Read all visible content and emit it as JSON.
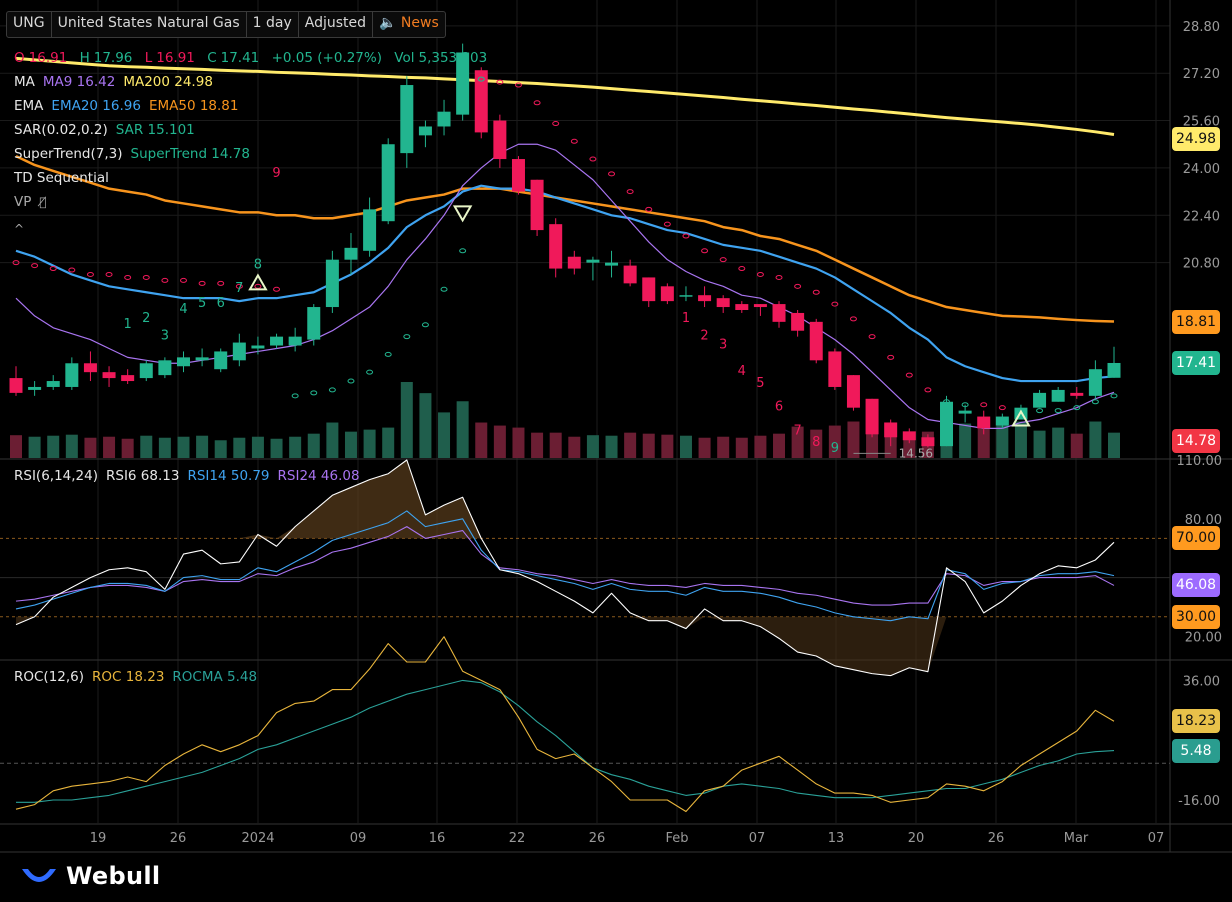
{
  "toolbar": {
    "symbol": "UNG",
    "name": "United States Natural Gas",
    "interval": "1 day",
    "adjust": "Adjusted",
    "news_label": "News"
  },
  "legend": {
    "ohlc": {
      "o_label": "O",
      "o": "16.91",
      "h_label": "H",
      "h": "17.96",
      "l_label": "L",
      "l": "16.91",
      "c_label": "C",
      "c": "17.41",
      "change": "+0.05 (+0.27%)",
      "vol_label": "Vol",
      "vol": "5,353,303"
    },
    "ma": {
      "name": "MA",
      "ma9": "MA9 16.42",
      "ma200": "MA200 24.98"
    },
    "ema": {
      "name": "EMA",
      "ema20": "EMA20 16.96",
      "ema50": "EMA50 18.81"
    },
    "sar": {
      "name": "SAR(0.02,0.2)",
      "sar": "SAR 15.101"
    },
    "supertrend": {
      "name": "SuperTrend(7,3)",
      "value": "SuperTrend 14.78"
    },
    "td": {
      "name": "TD Sequential"
    },
    "vp": {
      "name": "VP"
    },
    "rsi": {
      "name": "RSI(6,14,24)",
      "rsi6": "RSI6 68.13",
      "rsi14": "RSI14 50.79",
      "rsi24": "RSI24 46.08"
    },
    "roc": {
      "name": "ROC(12,6)",
      "roc": "ROC 18.23",
      "rocma": "ROCMA 5.48"
    }
  },
  "price_tags": [
    {
      "text": "24.98",
      "color": "#ffea6b"
    },
    {
      "text": "18.81",
      "color": "#ff9a1f"
    },
    {
      "text": "17.41",
      "color": "#22b58f"
    },
    {
      "text": "14.78",
      "color": "#f23645"
    },
    {
      "text": "70.00",
      "color": "#ff9a1f"
    },
    {
      "text": "46.08",
      "color": "#9d6bff"
    },
    {
      "text": "30.00",
      "color": "#ff9a1f"
    },
    {
      "text": "18.23",
      "color": "#e8c14a"
    },
    {
      "text": "5.48",
      "color": "#2a9d8f"
    }
  ],
  "colors": {
    "up": "#22b58f",
    "down": "#f0195a",
    "ma9": "#a874f0",
    "ma200": "#ffea6b",
    "ema20": "#3fa3f0",
    "ema50": "#f7941d",
    "rsi6": "#ffffff",
    "rsi14": "#3fa3f0",
    "rsi24": "#a874f0",
    "roc": "#e8b53c",
    "rocma": "#2aa198",
    "grid": "#222222",
    "logo": "#2f6bff"
  },
  "min_label": "14.56",
  "td_labels": {
    "buy_early": [
      "1",
      "2",
      "3",
      "4",
      "5",
      "6",
      "7",
      "8",
      "9"
    ],
    "sell_down": [
      "1",
      "2",
      "3",
      "4",
      "5",
      "6",
      "7",
      "8",
      "9"
    ]
  },
  "branding": "Webull",
  "chart_data": {
    "type": "candlestick",
    "price_axis": {
      "ticks": [
        "28.80",
        "27.20",
        "25.60",
        "24.00",
        "22.40",
        "20.80"
      ],
      "range": [
        14.2,
        29.2
      ]
    },
    "rsi_axis": {
      "ticks": [
        "110.00",
        "80.00",
        "20.00"
      ],
      "range": [
        10,
        110
      ]
    },
    "roc_axis": {
      "ticks": [
        "36.00",
        "-16.00"
      ],
      "range": [
        -26,
        44
      ]
    },
    "x_ticks": [
      "19",
      "26",
      "2024",
      "09",
      "16",
      "22",
      "26",
      "Feb",
      "07",
      "13",
      "20",
      "26",
      "Mar",
      "07"
    ],
    "candles": [
      {
        "o": 16.9,
        "h": 17.3,
        "l": 16.3,
        "c": 16.4
      },
      {
        "o": 16.5,
        "h": 16.8,
        "l": 16.3,
        "c": 16.6
      },
      {
        "o": 16.6,
        "h": 17.0,
        "l": 16.5,
        "c": 16.8
      },
      {
        "o": 16.6,
        "h": 17.6,
        "l": 16.5,
        "c": 17.4
      },
      {
        "o": 17.4,
        "h": 17.8,
        "l": 16.8,
        "c": 17.1
      },
      {
        "o": 17.1,
        "h": 17.3,
        "l": 16.6,
        "c": 16.9
      },
      {
        "o": 17.0,
        "h": 17.2,
        "l": 16.7,
        "c": 16.8
      },
      {
        "o": 16.9,
        "h": 17.5,
        "l": 16.8,
        "c": 17.4
      },
      {
        "o": 17.0,
        "h": 17.6,
        "l": 16.9,
        "c": 17.5
      },
      {
        "o": 17.3,
        "h": 17.8,
        "l": 17.1,
        "c": 17.6
      },
      {
        "o": 17.5,
        "h": 17.9,
        "l": 17.3,
        "c": 17.6
      },
      {
        "o": 17.2,
        "h": 17.9,
        "l": 17.1,
        "c": 17.8
      },
      {
        "o": 17.5,
        "h": 18.4,
        "l": 17.3,
        "c": 18.1
      },
      {
        "o": 17.9,
        "h": 18.3,
        "l": 17.7,
        "c": 18.0
      },
      {
        "o": 18.0,
        "h": 18.4,
        "l": 17.9,
        "c": 18.3
      },
      {
        "o": 18.0,
        "h": 18.6,
        "l": 17.8,
        "c": 18.3
      },
      {
        "o": 18.2,
        "h": 19.4,
        "l": 18.0,
        "c": 19.3
      },
      {
        "o": 19.3,
        "h": 21.2,
        "l": 19.1,
        "c": 20.9
      },
      {
        "o": 20.9,
        "h": 21.8,
        "l": 20.4,
        "c": 21.3
      },
      {
        "o": 21.2,
        "h": 23.0,
        "l": 21.0,
        "c": 22.6
      },
      {
        "o": 22.2,
        "h": 25.0,
        "l": 22.1,
        "c": 24.8
      },
      {
        "o": 24.5,
        "h": 27.1,
        "l": 24.0,
        "c": 26.8
      },
      {
        "o": 25.1,
        "h": 25.6,
        "l": 24.7,
        "c": 25.4
      },
      {
        "o": 25.4,
        "h": 26.3,
        "l": 25.1,
        "c": 25.9
      },
      {
        "o": 25.8,
        "h": 28.2,
        "l": 25.6,
        "c": 27.9
      },
      {
        "o": 27.3,
        "h": 27.4,
        "l": 25.0,
        "c": 25.2
      },
      {
        "o": 25.6,
        "h": 25.8,
        "l": 24.0,
        "c": 24.3
      },
      {
        "o": 24.3,
        "h": 24.4,
        "l": 23.1,
        "c": 23.2
      },
      {
        "o": 23.6,
        "h": 23.6,
        "l": 21.7,
        "c": 21.9
      },
      {
        "o": 22.1,
        "h": 22.3,
        "l": 20.3,
        "c": 20.6
      },
      {
        "o": 21.0,
        "h": 21.2,
        "l": 20.4,
        "c": 20.6
      },
      {
        "o": 20.8,
        "h": 21.0,
        "l": 20.2,
        "c": 20.9
      },
      {
        "o": 20.7,
        "h": 21.2,
        "l": 20.3,
        "c": 20.8
      },
      {
        "o": 20.7,
        "h": 20.9,
        "l": 20.0,
        "c": 20.1
      },
      {
        "o": 20.3,
        "h": 20.3,
        "l": 19.3,
        "c": 19.5
      },
      {
        "o": 20.0,
        "h": 20.1,
        "l": 19.4,
        "c": 19.5
      },
      {
        "o": 19.7,
        "h": 20.0,
        "l": 19.5,
        "c": 19.7
      },
      {
        "o": 19.7,
        "h": 20.0,
        "l": 19.3,
        "c": 19.5
      },
      {
        "o": 19.6,
        "h": 19.7,
        "l": 19.1,
        "c": 19.3
      },
      {
        "o": 19.4,
        "h": 19.5,
        "l": 19.1,
        "c": 19.2
      },
      {
        "o": 19.4,
        "h": 19.4,
        "l": 19.0,
        "c": 19.3
      },
      {
        "o": 19.4,
        "h": 19.5,
        "l": 18.6,
        "c": 18.8
      },
      {
        "o": 19.1,
        "h": 19.2,
        "l": 18.3,
        "c": 18.5
      },
      {
        "o": 18.8,
        "h": 18.9,
        "l": 17.4,
        "c": 17.5
      },
      {
        "o": 17.8,
        "h": 17.9,
        "l": 16.5,
        "c": 16.6
      },
      {
        "o": 17.0,
        "h": 17.0,
        "l": 15.8,
        "c": 15.9
      },
      {
        "o": 16.2,
        "h": 16.2,
        "l": 14.9,
        "c": 15.0
      },
      {
        "o": 15.4,
        "h": 15.5,
        "l": 14.6,
        "c": 14.9
      },
      {
        "o": 15.1,
        "h": 15.2,
        "l": 14.7,
        "c": 14.8
      },
      {
        "o": 14.9,
        "h": 15.0,
        "l": 14.56,
        "c": 14.6
      },
      {
        "o": 14.6,
        "h": 16.3,
        "l": 14.6,
        "c": 16.1
      },
      {
        "o": 15.7,
        "h": 16.0,
        "l": 15.4,
        "c": 15.8
      },
      {
        "o": 15.6,
        "h": 15.8,
        "l": 15.0,
        "c": 15.2
      },
      {
        "o": 15.3,
        "h": 15.7,
        "l": 15.2,
        "c": 15.6
      },
      {
        "o": 15.5,
        "h": 16.0,
        "l": 15.5,
        "c": 15.9
      },
      {
        "o": 15.9,
        "h": 16.5,
        "l": 15.9,
        "c": 16.4
      },
      {
        "o": 16.1,
        "h": 16.6,
        "l": 16.1,
        "c": 16.5
      },
      {
        "o": 16.4,
        "h": 16.6,
        "l": 16.2,
        "c": 16.3
      },
      {
        "o": 16.3,
        "h": 17.5,
        "l": 16.2,
        "c": 17.2
      },
      {
        "o": 16.91,
        "h": 17.96,
        "l": 16.91,
        "c": 17.41
      }
    ],
    "volume": [
      45,
      42,
      44,
      46,
      40,
      42,
      38,
      44,
      40,
      42,
      44,
      35,
      40,
      42,
      38,
      42,
      48,
      70,
      52,
      56,
      60,
      150,
      128,
      90,
      112,
      70,
      64,
      60,
      50,
      50,
      42,
      45,
      44,
      50,
      48,
      46,
      44,
      40,
      42,
      40,
      44,
      48,
      62,
      56,
      64,
      72,
      62,
      55,
      48,
      52,
      74,
      68,
      58,
      66,
      72,
      54,
      60,
      48,
      72,
      50
    ],
    "ma9": [
      19.6,
      19.0,
      18.6,
      18.4,
      18.2,
      17.9,
      17.6,
      17.5,
      17.4,
      17.4,
      17.5,
      17.6,
      17.7,
      17.8,
      17.9,
      18.0,
      18.2,
      18.5,
      18.9,
      19.3,
      20.0,
      20.9,
      21.6,
      22.4,
      23.4,
      24.0,
      24.5,
      24.8,
      24.8,
      24.6,
      24.1,
      23.6,
      22.9,
      22.2,
      21.5,
      20.9,
      20.5,
      20.2,
      20.0,
      19.7,
      19.6,
      19.3,
      19.0,
      18.6,
      18.2,
      17.7,
      17.1,
      16.5,
      15.9,
      15.5,
      15.4,
      15.3,
      15.2,
      15.2,
      15.4,
      15.5,
      15.7,
      15.9,
      16.2,
      16.42
    ],
    "ema20": [
      21.2,
      21.0,
      20.7,
      20.4,
      20.2,
      20.0,
      19.9,
      19.8,
      19.7,
      19.6,
      19.6,
      19.6,
      19.5,
      19.6,
      19.6,
      19.7,
      19.8,
      20.1,
      20.4,
      20.8,
      21.3,
      22.0,
      22.4,
      22.7,
      23.2,
      23.4,
      23.3,
      23.3,
      23.2,
      23.0,
      22.8,
      22.6,
      22.4,
      22.3,
      22.1,
      21.9,
      21.8,
      21.6,
      21.4,
      21.3,
      21.2,
      21.0,
      20.8,
      20.6,
      20.3,
      19.9,
      19.5,
      19.1,
      18.6,
      18.2,
      17.6,
      17.3,
      17.1,
      16.9,
      16.8,
      16.8,
      16.8,
      16.8,
      16.9,
      16.96
    ],
    "ema50": [
      24.4,
      24.1,
      23.9,
      23.7,
      23.5,
      23.3,
      23.2,
      23.1,
      22.9,
      22.8,
      22.7,
      22.6,
      22.5,
      22.5,
      22.4,
      22.4,
      22.3,
      22.3,
      22.4,
      22.5,
      22.7,
      22.9,
      23.0,
      23.1,
      23.3,
      23.3,
      23.3,
      23.2,
      23.1,
      23.0,
      22.9,
      22.8,
      22.7,
      22.6,
      22.5,
      22.4,
      22.3,
      22.2,
      22.0,
      21.9,
      21.7,
      21.6,
      21.4,
      21.2,
      20.9,
      20.6,
      20.3,
      20.0,
      19.7,
      19.5,
      19.3,
      19.2,
      19.1,
      19.0,
      18.98,
      18.95,
      18.9,
      18.86,
      18.83,
      18.81
    ],
    "ma200": [
      27.7,
      27.65,
      27.6,
      27.55,
      27.5,
      27.45,
      27.42,
      27.4,
      27.37,
      27.35,
      27.33,
      27.3,
      27.28,
      27.26,
      27.23,
      27.21,
      27.19,
      27.16,
      27.14,
      27.11,
      27.09,
      27.06,
      27.04,
      27.01,
      26.98,
      26.95,
      26.92,
      26.88,
      26.85,
      26.81,
      26.77,
      26.73,
      26.68,
      26.63,
      26.58,
      26.53,
      26.48,
      26.43,
      26.38,
      26.32,
      26.27,
      26.22,
      26.16,
      26.11,
      26.05,
      25.99,
      25.94,
      25.88,
      25.82,
      25.76,
      25.7,
      25.65,
      25.6,
      25.55,
      25.5,
      25.44,
      25.37,
      25.3,
      25.22,
      25.13
    ],
    "sar": [
      20.8,
      20.7,
      20.6,
      20.55,
      20.4,
      20.4,
      20.3,
      20.3,
      20.2,
      20.2,
      20.1,
      20.1,
      20.0,
      20.0,
      19.9,
      16.3,
      16.4,
      16.5,
      16.8,
      17.1,
      17.7,
      18.3,
      18.7,
      19.9,
      21.2,
      27.0,
      26.9,
      26.8,
      26.2,
      25.5,
      24.9,
      24.3,
      23.8,
      23.2,
      22.6,
      22.1,
      21.7,
      21.2,
      20.9,
      20.6,
      20.4,
      20.3,
      20.0,
      19.8,
      19.4,
      18.9,
      18.3,
      17.6,
      17.0,
      16.5,
      16.1,
      16.0,
      16.0,
      15.9,
      15.8,
      15.8,
      15.8,
      15.9,
      16.1,
      16.3
    ],
    "rsi6": [
      26,
      30,
      40,
      45,
      50,
      54,
      55,
      53,
      44,
      62,
      64,
      57,
      58,
      72,
      66,
      76,
      84,
      92,
      96,
      100,
      103,
      110,
      82,
      87,
      91,
      70,
      54,
      52,
      48,
      43,
      38,
      32,
      42,
      32,
      28,
      28,
      24,
      34,
      28,
      28,
      25,
      19,
      12,
      10,
      5,
      3,
      1,
      0,
      4,
      2,
      55,
      48,
      32,
      38,
      46,
      52,
      56,
      55,
      59,
      68
    ],
    "rsi14": [
      34,
      36,
      39,
      42,
      45,
      47,
      47,
      46,
      43,
      50,
      51,
      49,
      49,
      55,
      53,
      58,
      63,
      69,
      72,
      75,
      78,
      84,
      76,
      78,
      80,
      64,
      54,
      53,
      51,
      49,
      47,
      44,
      47,
      44,
      43,
      43,
      41,
      45,
      43,
      43,
      42,
      40,
      37,
      35,
      32,
      30,
      29,
      28,
      30,
      29,
      54,
      52,
      44,
      47,
      48,
      51,
      52,
      52,
      53,
      51
    ],
    "rsi24": [
      38,
      39,
      41,
      43,
      45,
      46,
      46,
      45,
      43,
      48,
      49,
      48,
      48,
      52,
      51,
      55,
      58,
      63,
      65,
      68,
      71,
      76,
      70,
      72,
      74,
      62,
      55,
      54,
      52,
      51,
      49,
      47,
      49,
      47,
      46,
      46,
      45,
      47,
      46,
      46,
      45,
      44,
      42,
      41,
      39,
      37,
      36,
      36,
      37,
      37,
      52,
      51,
      46,
      48,
      48,
      50,
      50,
      50,
      51,
      46
    ],
    "roc": [
      -20,
      -18,
      -12,
      -10,
      -9,
      -8,
      -6,
      -8,
      -1,
      4,
      8,
      5,
      8,
      12,
      22,
      26,
      27,
      32,
      32,
      41,
      52,
      44,
      44,
      55,
      40,
      36,
      32,
      20,
      6,
      2,
      4,
      -2,
      -8,
      -16,
      -16,
      -16,
      -21,
      -12,
      -10,
      -3,
      0,
      3,
      -3,
      -9,
      -13,
      -13,
      -14,
      -17,
      -16,
      -15,
      -9,
      -10,
      -12,
      -8,
      -1,
      4,
      9,
      14,
      23,
      18.23
    ],
    "rocma": [
      -17,
      -17,
      -16,
      -16,
      -15,
      -14,
      -12,
      -10,
      -8,
      -6,
      -4,
      -1,
      2,
      6,
      8,
      11,
      14,
      17,
      20,
      24,
      27,
      30,
      32,
      34,
      36,
      35,
      31,
      25,
      18,
      12,
      5,
      -2,
      -5,
      -7,
      -10,
      -12,
      -14,
      -13,
      -10,
      -9,
      -10,
      -11,
      -13,
      -14,
      -15,
      -15,
      -15,
      -14,
      -13,
      -12,
      -11,
      -11,
      -9,
      -7,
      -4,
      -1,
      1,
      4,
      5,
      5.48
    ]
  }
}
